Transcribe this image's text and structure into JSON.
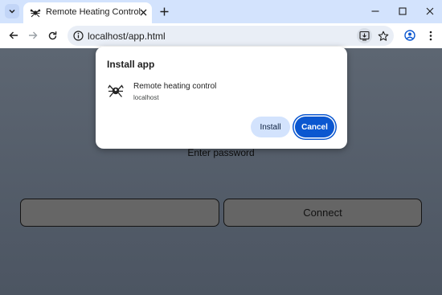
{
  "browser": {
    "tab": {
      "title": "Remote Heating Control"
    },
    "omnibox": {
      "url": "localhost/app.html"
    },
    "icons": {
      "tab_search": "chevron-down-icon",
      "favicon": "spider-icon",
      "tab_close": "close-icon",
      "new_tab": "plus-icon",
      "minimize": "minimize-icon",
      "maximize": "maximize-icon",
      "close_window": "close-icon",
      "back": "arrow-left-icon",
      "forward": "arrow-right-icon",
      "reload": "reload-icon",
      "site_info": "info-icon",
      "install_app": "install-icon",
      "bookmark": "star-icon",
      "profile": "profile-icon",
      "menu": "kebab-menu-icon"
    },
    "colors": {
      "tabstrip": "#d3e3fd",
      "accent": "#0b57d0"
    }
  },
  "dialog": {
    "title": "Install app",
    "app_name": "Remote heating control",
    "origin": "localhost",
    "install_label": "Install",
    "cancel_label": "Cancel"
  },
  "page": {
    "password_label": "Enter password",
    "password_value": "",
    "connect_label": "Connect"
  }
}
